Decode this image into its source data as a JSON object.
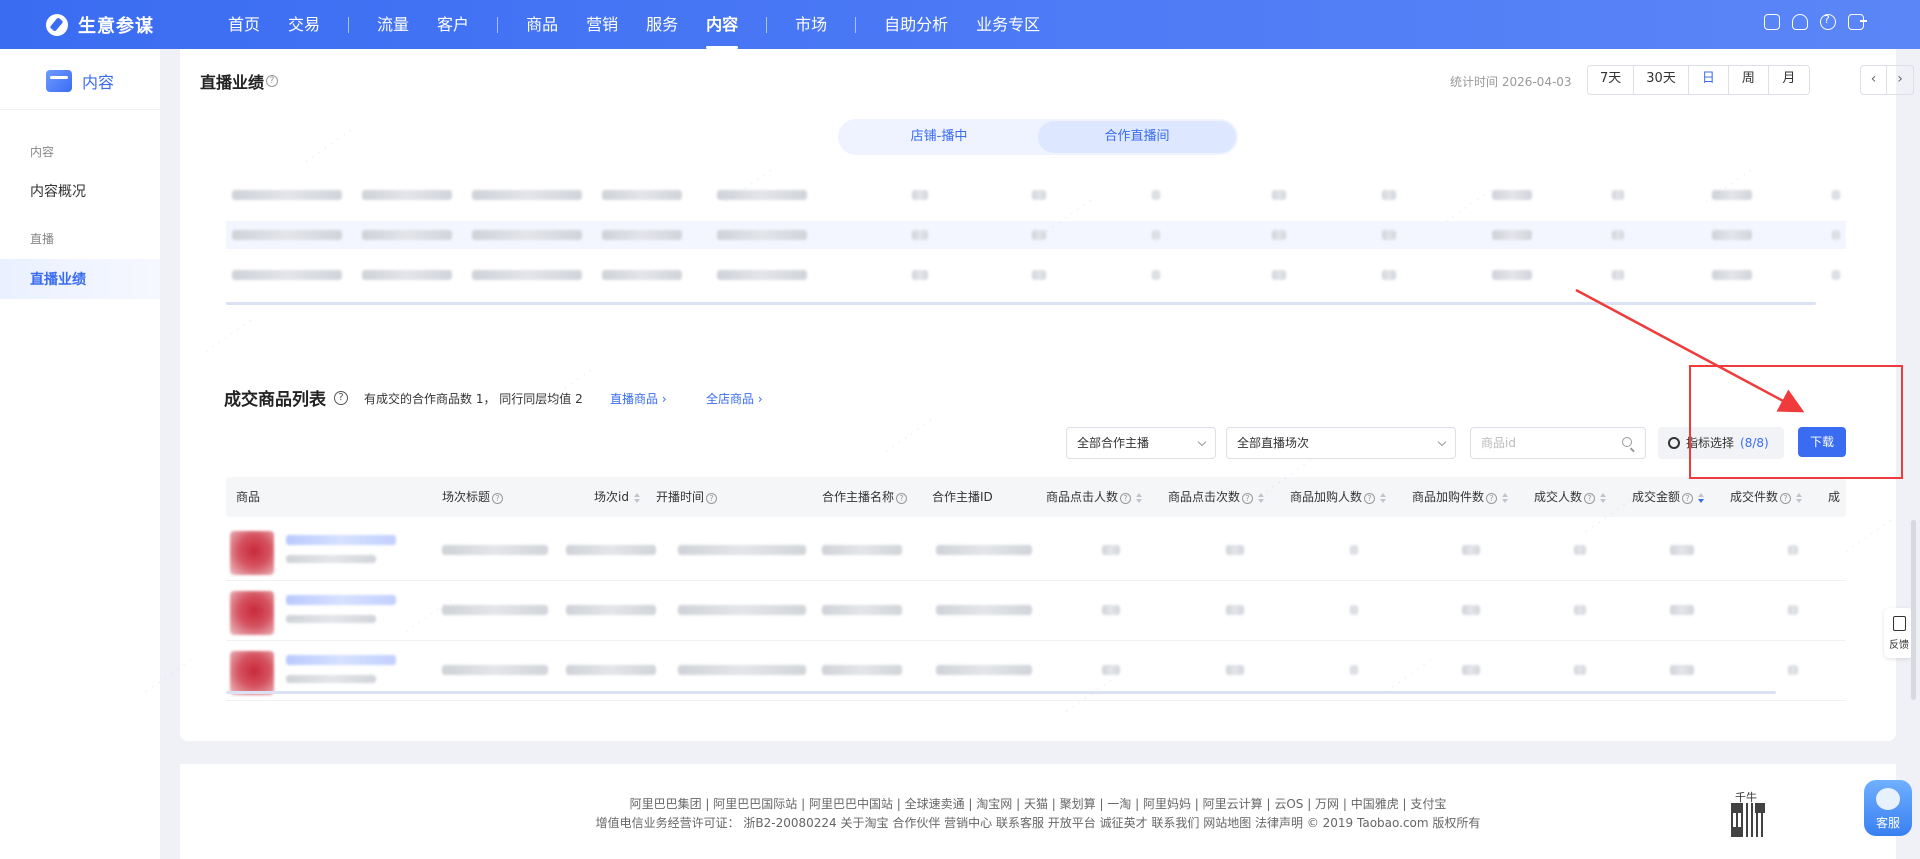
{
  "nav": {
    "brand": "生意参谋",
    "items": [
      {
        "label": "首页"
      },
      {
        "label": "交易"
      },
      {
        "sep": true
      },
      {
        "label": "流量"
      },
      {
        "label": "客户"
      },
      {
        "sep": true
      },
      {
        "label": "商品"
      },
      {
        "label": "营销"
      },
      {
        "label": "服务"
      },
      {
        "label": "内容",
        "active": true
      },
      {
        "sep": true
      },
      {
        "label": "市场"
      },
      {
        "sep": true
      },
      {
        "label": "自助分析"
      },
      {
        "label": "业务专区"
      }
    ],
    "icons": [
      "calendar-icon",
      "user-icon",
      "help-icon",
      "logout-icon"
    ]
  },
  "sidebar": {
    "title": "内容",
    "group1": "内容",
    "item1": "内容概况",
    "group2": "直播",
    "item2": "直播业绩"
  },
  "live": {
    "title": "直播业绩",
    "stat_time": "统计时间 2026-04-03",
    "time_tabs": [
      "7天",
      "30天",
      "日",
      "周",
      "月"
    ],
    "active_tab": "日",
    "seg_tabs": [
      "店铺-播中",
      "合作直播间"
    ],
    "seg_active": "合作直播间"
  },
  "goods": {
    "title": "成交商品列表",
    "desc": "有成交的合作商品数 1， 同行同层均值 2",
    "link1": "直播商品 ›",
    "link2": "全店商品 ›",
    "filter_anchor": "全部合作主播",
    "filter_session": "全部直播场次",
    "search_placeholder": "商品id",
    "metric_label": "指标选择",
    "metric_count": "(8/8)",
    "download": "下载",
    "columns": [
      "商品",
      "场次标题",
      "场次id",
      "开播时间",
      "合作主播名称",
      "合作主播ID",
      "商品点击人数",
      "商品点击次数",
      "商品加购人数",
      "商品加购件数",
      "成交人数",
      "成交金额",
      "成交件数",
      "成"
    ]
  },
  "feedback": "反馈",
  "footer": {
    "line1": "阿里巴巴集团 | 阿里巴巴国际站 | 阿里巴巴中国站 | 全球速卖通 | 淘宝网 | 天猫 | 聚划算 | 一淘 | 阿里妈妈 | 阿里云计算 | 云OS | 万网 | 中国雅虎 | 支付宝",
    "line2": "增值电信业务经营许可证： 浙B2-20080224  关于淘宝  合作伙伴  营销中心  联系客服  开放平台  诚征英才  联系我们  网站地图  法律声明 © 2019 Taobao.com 版权所有",
    "qn_label": "千牛",
    "service": "客服"
  },
  "colors": {
    "accent": "#3a6cf2",
    "annotation": "#ef3b3b"
  }
}
